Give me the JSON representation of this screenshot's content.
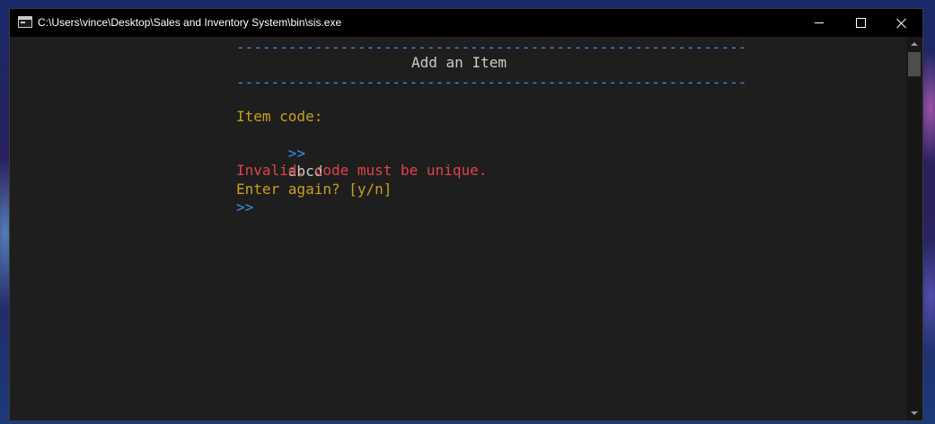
{
  "window": {
    "title": "C:\\Users\\vince\\Desktop\\Sales and Inventory System\\bin\\sis.exe",
    "icon": "console-app-icon",
    "controls": {
      "minimize": "minimize-icon",
      "maximize": "maximize-icon",
      "close": "close-icon"
    }
  },
  "colors": {
    "console_background": "#1e1e1e",
    "divider": "#3b8eea",
    "heading": "#cccccc",
    "prompt_label": "#c8a017",
    "input_marker": "#3b8eea",
    "error": "#e0414a"
  },
  "console": {
    "divider_top": "-----------------------------------------------------------",
    "heading": "Add an Item",
    "divider_bottom": "-----------------------------------------------------------",
    "item_code_label": "Item code:",
    "input_marker_1": ">>",
    "input_value_1": "abcd",
    "error_message": "Invalid, code must be unique.",
    "retry_prompt": "Enter again? [y/n]",
    "input_marker_2": ">>"
  }
}
